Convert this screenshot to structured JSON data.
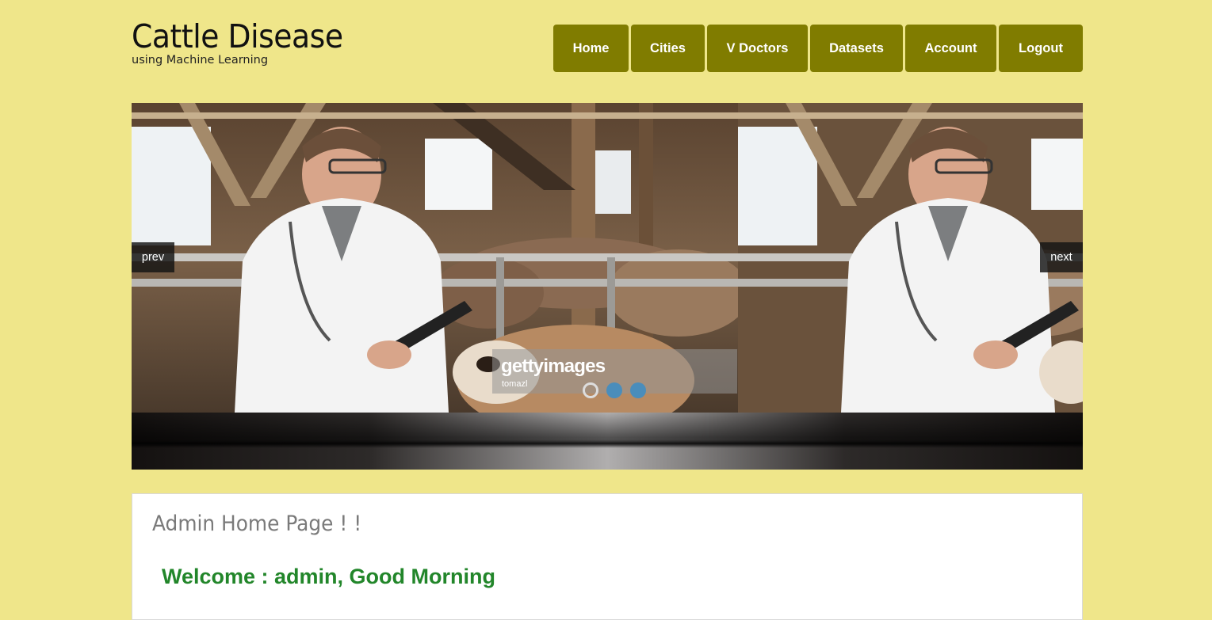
{
  "logo": {
    "title": "Cattle Disease",
    "subtitle": "using Machine Learning"
  },
  "nav": {
    "items": [
      {
        "label": "Home"
      },
      {
        "label": "Cities"
      },
      {
        "label": "V Doctors"
      },
      {
        "label": "Datasets"
      },
      {
        "label": "Account"
      },
      {
        "label": "Logout"
      }
    ]
  },
  "slider": {
    "prev_label": "prev",
    "next_label": "next",
    "watermark": "gettyimages",
    "watermark_credit": "tomazl",
    "slide_count": 3,
    "active_slide": 1
  },
  "content": {
    "heading": "Admin Home Page ! !",
    "welcome": "Welcome : admin, Good Morning"
  },
  "colors": {
    "page_bg": "#efe68a",
    "nav_bg": "#807c00",
    "welcome": "#22862a",
    "heading": "#7a7a7a"
  }
}
